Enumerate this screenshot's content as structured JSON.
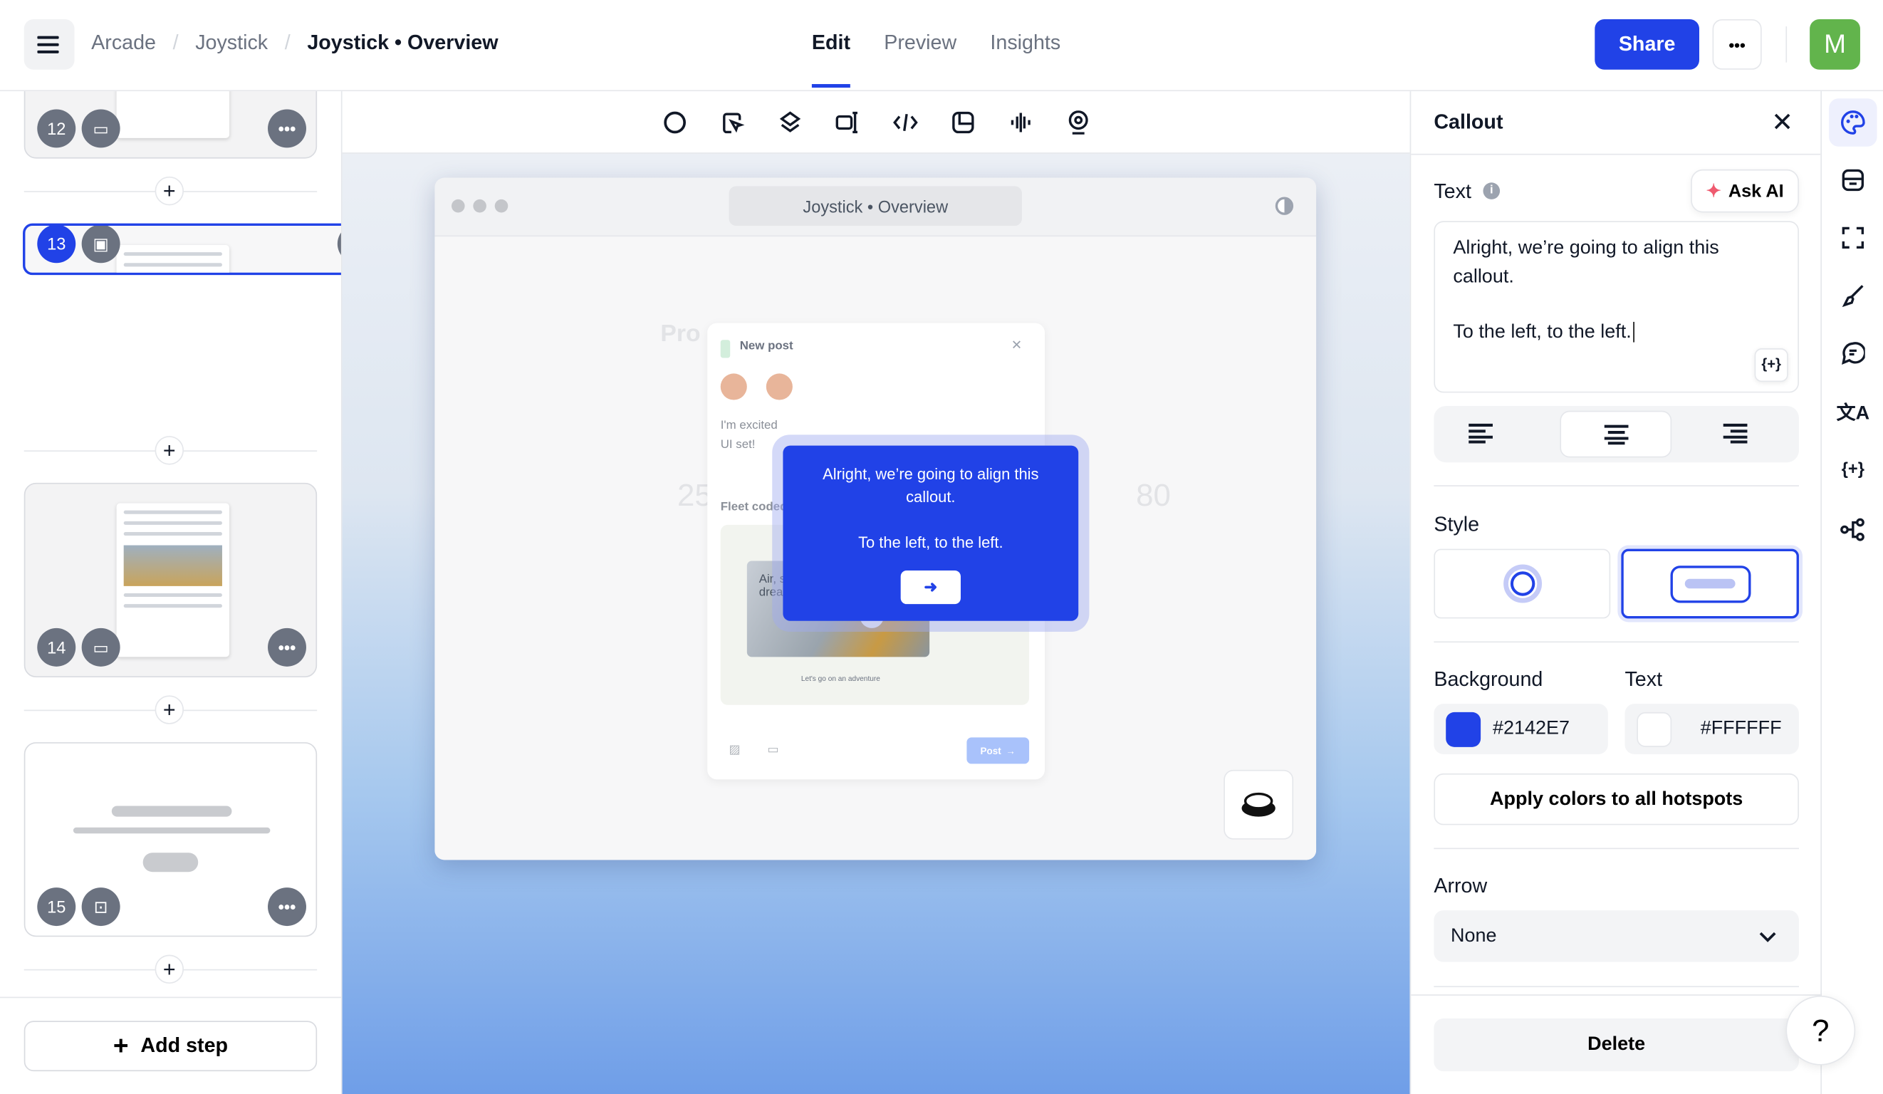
{
  "header": {
    "breadcrumbs": [
      "Arcade",
      "Joystick",
      "Joystick • Overview"
    ],
    "tabs": [
      {
        "label": "Edit",
        "active": true
      },
      {
        "label": "Preview"
      },
      {
        "label": "Insights"
      }
    ],
    "share_label": "Share",
    "avatar_initial": "M",
    "accent": "#2142E7"
  },
  "sidebar": {
    "steps": [
      {
        "number": "12",
        "type": "video"
      },
      {
        "number": "13",
        "type": "image",
        "selected": true
      },
      {
        "number": "14",
        "type": "video"
      },
      {
        "number": "15",
        "type": "chapter"
      }
    ],
    "add_step_label": "Add step"
  },
  "toolbar": {
    "icons": [
      "hotspot-icon",
      "pan-zoom-icon",
      "layers-icon",
      "resize-icon",
      "code-icon",
      "crop-icon",
      "audio-icon",
      "webcam-icon"
    ]
  },
  "preview": {
    "browser_title": "Joystick • Overview",
    "post_title": "New post",
    "post_text": [
      "I'm excited",
      "UI set!"
    ],
    "section_label": "Fleet coded",
    "hero_title": "Air, sleep, dream",
    "hero_caption": "Let's go on an adventure",
    "post_button": "Post",
    "callout": {
      "line1": "Alright, we’re going to align this callout.",
      "line2": "To the left, to the left.",
      "background": "#2142E7",
      "text_color": "#FFFFFF"
    }
  },
  "panel": {
    "title": "Callout",
    "text_label": "Text",
    "ask_ai_label": "Ask AI",
    "text_value_line1": "Alright, we’re going to align this callout.",
    "text_value_line2": "To the left, to the left.",
    "alignment": "center",
    "style_label": "Style",
    "style_selected": "callout",
    "background_label": "Background",
    "background_value": "#2142E7",
    "text_color_label": "Text",
    "text_color_value": "#FFFFFF",
    "apply_colors_label": "Apply colors to all hotspots",
    "arrow_label": "Arrow",
    "arrow_value": "None",
    "delete_label": "Delete",
    "help_label": "?"
  }
}
